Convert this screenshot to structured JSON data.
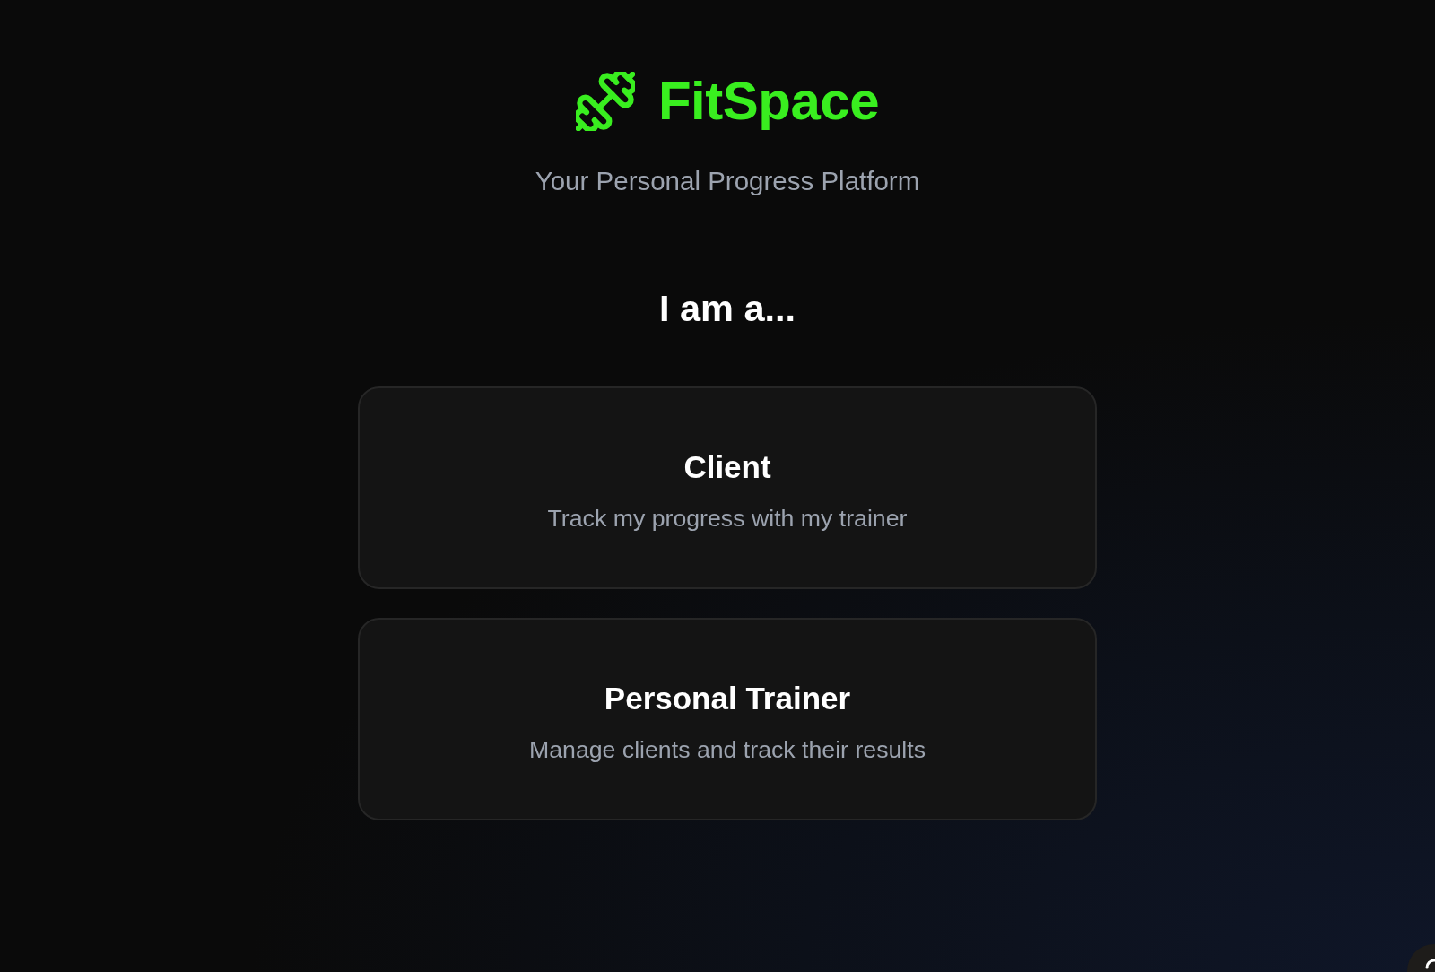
{
  "brand": {
    "name": "FitSpace",
    "tagline": "Your Personal Progress Platform"
  },
  "heading": "I am a...",
  "roles": [
    {
      "title": "Client",
      "description": "Track my progress with my trainer",
      "selected": false
    },
    {
      "title": "Personal Trainer",
      "description": "Manage clients and track their results",
      "selected": false
    }
  ]
}
